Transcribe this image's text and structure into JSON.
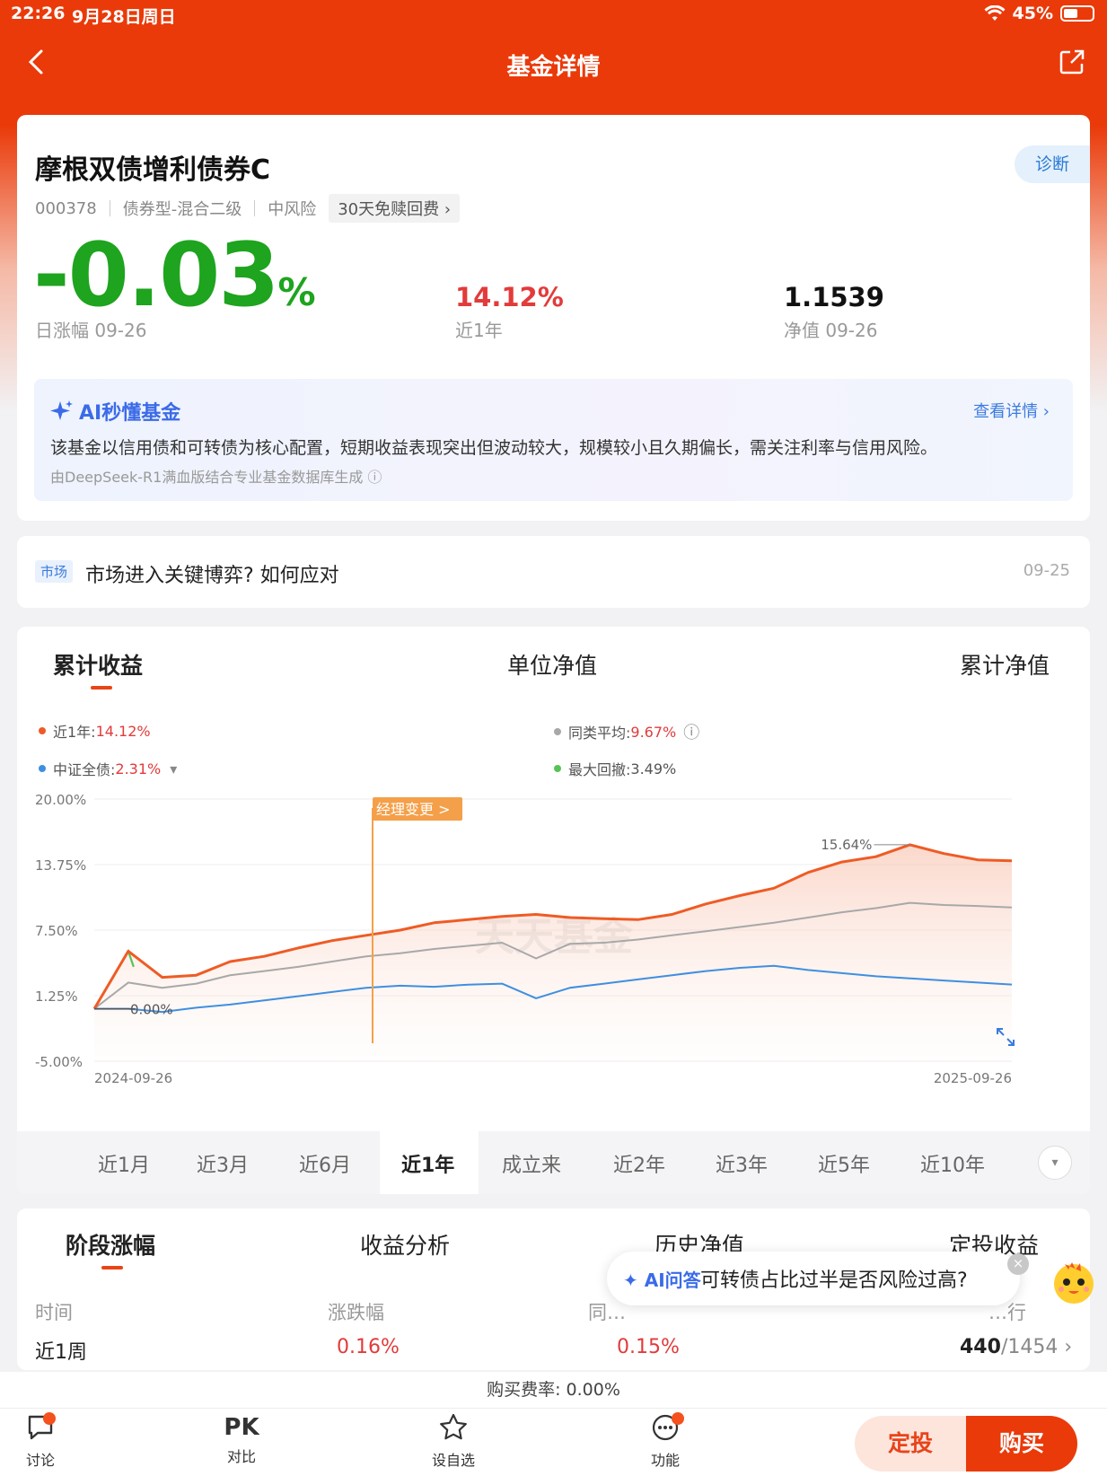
{
  "status": {
    "time": "22:26",
    "date": "9月28日周日",
    "battery": "45%"
  },
  "nav": {
    "title": "基金详情"
  },
  "fund": {
    "name": "摩根双债增利债券C",
    "diagnose": "诊断",
    "code": "000378",
    "type": "债券型-混合二级",
    "risk": "中风险",
    "fee_tag": "30天免赎回费 ›",
    "daily_change_num": "-0.03",
    "daily_change_pct": "%",
    "daily_change_label": "日涨幅 09-26",
    "year_return": "14.12%",
    "year_return_label": "近1年",
    "nav_value": "1.1539",
    "nav_label": "净值 09-26"
  },
  "ai": {
    "title": "AI秒懂基金",
    "more": "查看详情 ›",
    "text": "该基金以信用债和可转债为核心配置，短期收益表现突出但波动较大，规模较小且久期偏长，需关注利率与信用风险。",
    "source": "由DeepSeek-R1满血版结合专业基金数据库生成 ⓘ"
  },
  "market": {
    "tag": "市场",
    "text": "市场进入关键博弈? 如何应对",
    "date": "09-25"
  },
  "chart_tabs": [
    "累计收益",
    "单位净值",
    "累计净值"
  ],
  "legend": {
    "l1_label": "近1年:",
    "l1_value": "14.12%",
    "l2_label": "同类平均:",
    "l2_value": "9.67%",
    "l2_info": "ⓘ",
    "l3_label": "中证全债:",
    "l3_value": "2.31%",
    "l3_caret": "▾",
    "l4_label": "最大回撤:",
    "l4_value": "3.49%"
  },
  "colors": {
    "fund": "#ef5b25",
    "peer": "#a8a8a8",
    "index": "#3f8fe0",
    "drawdown": "#55c455",
    "brand": "#ea3a0a"
  },
  "chart_data": {
    "type": "line",
    "xlabel": "",
    "ylabel": "",
    "x_range": [
      "2024-09-26",
      "2025-09-26"
    ],
    "x_tick_labels": [
      "2024-09-26",
      "2025-09-26"
    ],
    "ylim": [
      -5.0,
      20.0
    ],
    "y_ticks": [
      "20.00%",
      "13.75%",
      "7.50%",
      "1.25%",
      "-5.00%"
    ],
    "annotations": {
      "max": "15.64%",
      "start": "0.00%",
      "event": "经理变更 >"
    },
    "watermark": "天天基金",
    "series": [
      {
        "name": "近1年",
        "values": [
          0,
          5.5,
          3,
          3.2,
          4.5,
          5,
          5.8,
          6.5,
          7,
          7.5,
          8.2,
          8.5,
          8.8,
          9,
          8.7,
          8.6,
          8.5,
          9,
          10,
          10.8,
          11.5,
          13,
          14,
          14.5,
          15.64,
          14.8,
          14.2,
          14.12
        ]
      },
      {
        "name": "同类平均",
        "values": [
          0,
          2.5,
          2,
          2.4,
          3.2,
          3.6,
          4.0,
          4.5,
          5,
          5.3,
          5.7,
          6.0,
          6.3,
          4.8,
          6.2,
          6.3,
          6.6,
          7.0,
          7.4,
          7.8,
          8.2,
          8.7,
          9.2,
          9.6,
          10.1,
          9.9,
          9.8,
          9.67
        ]
      },
      {
        "name": "中证全债",
        "values": [
          0,
          0,
          -0.3,
          0.1,
          0.4,
          0.8,
          1.2,
          1.6,
          2.0,
          2.2,
          2.1,
          2.3,
          2.4,
          1.0,
          2.0,
          2.4,
          2.8,
          3.2,
          3.6,
          3.9,
          4.1,
          3.7,
          3.4,
          3.1,
          2.9,
          2.7,
          2.5,
          2.31
        ]
      }
    ]
  },
  "ranges": [
    "近1月",
    "近3月",
    "近6月",
    "近1年",
    "成立来",
    "近2年",
    "近3年",
    "近5年",
    "近10年"
  ],
  "range_more": "▾",
  "stage_tabs": [
    "阶段涨幅",
    "收益分析",
    "历史净值",
    "定投收益"
  ],
  "stage_table": {
    "headers": [
      "时间",
      "涨跌幅",
      "同…",
      "…行"
    ],
    "row": {
      "period": "近1周",
      "change": "0.16%",
      "peer": "0.15%",
      "rank_a": "440",
      "rank_b": "/1454 ›"
    }
  },
  "ai_ask": {
    "label": "AI问答",
    "question": "可转债占比过半是否风险过高?",
    "close": "×"
  },
  "fee": "购买费率: 0.00%",
  "bottom": {
    "discuss": "讨论",
    "pk": "PK",
    "compare": "对比",
    "watch": "设自选",
    "func": "功能",
    "sip": "定投",
    "buy": "购买"
  }
}
